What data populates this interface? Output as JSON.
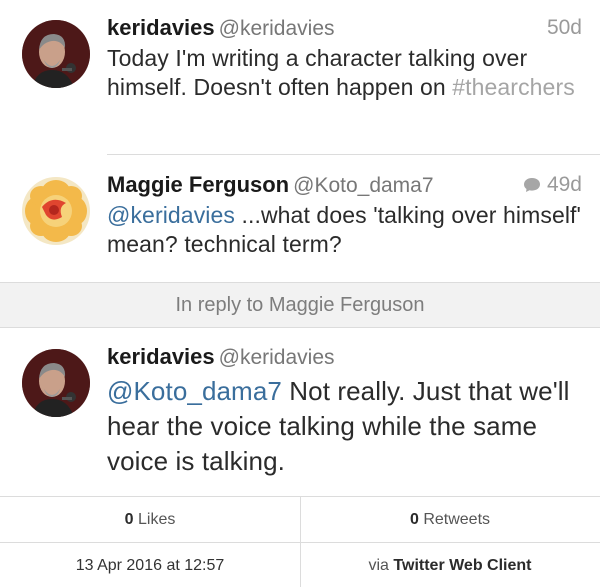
{
  "tweets": [
    {
      "name": "keridavies",
      "handle": "@keridavies",
      "time": "50d",
      "text_main": "Today I'm writing a character talking over himself. Doesn't often happen on ",
      "hashtag": "#thearchers"
    },
    {
      "name": "Maggie Ferguson",
      "handle": "@Koto_dama7",
      "time": "49d",
      "mention": "@keridavies",
      "text_rest": " ...what does 'talking over himself' mean? technical term?"
    }
  ],
  "reply_bar": {
    "label": "In reply to Maggie Ferguson"
  },
  "focus_tweet": {
    "name": "keridavies",
    "handle": "@keridavies",
    "mention": "@Koto_dama7",
    "text_rest": " Not really. Just that we'll hear the voice talking while the same voice is talking."
  },
  "stats": {
    "likes_count": "0",
    "likes_label": " Likes",
    "retweets_count": "0",
    "retweets_label": " Retweets",
    "date": "13 Apr 2016 at 12:57",
    "via_prefix": "via ",
    "client": "Twitter Web Client"
  },
  "colors": {
    "link": "#3a6e9c",
    "muted": "#9a9a9a",
    "separator": "#dcdcdc",
    "reply_bar_bg": "#f2f2f2"
  },
  "icons": [
    "avatar-man-microphone",
    "avatar-flower",
    "speech-bubble-icon"
  ]
}
